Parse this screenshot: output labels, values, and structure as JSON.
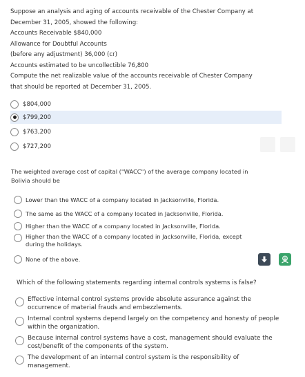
{
  "question1": {
    "lines": [
      "Suppose an analysis and aging of accounts receivable of the Chester Company at",
      "December 31, 2005, showed the following:",
      "Accounts Receivable $840,000",
      "Allowance for Doubtful Accounts",
      "(before any adjustment) 36,000 (cr)",
      "Accounts estimated to be uncollectible 76,800",
      "Compute the net realizable value of the accounts receivable of Chester Company",
      "that should be reported at December 31, 2005."
    ],
    "options": [
      "$804,000",
      "$799,200",
      "$763,200",
      "$727,200"
    ],
    "selected_index": 1
  },
  "question2": {
    "lines": [
      "The weighted average cost of capital (\"WACC\") of the average company located in",
      "Bolivia should be"
    ],
    "options": [
      "Lower than the WACC of a company located in Jacksonville, Florida.",
      "The same as the WACC of a company located in Jacksonville, Florida.",
      "Higher than the WACC of a company located in Jacksonville, Florida.",
      "Higher than the WACC of a company located in Jacksonville, Florida, except during the holidays.",
      "None of the above."
    ]
  },
  "toolbar": {
    "download_icon": "download-icon",
    "share_icon": "share-icon",
    "download_color": "#3d4a57",
    "share_color": "#3aa36a"
  },
  "question3": {
    "text": "Which of the following statements regarding internal controls systems is false?",
    "options": [
      "Effective internal control systems provide absolute assurance against the occurrence of material frauds and embezzlements.",
      "Internal control systems depend largely on the competency and honesty of people within the organization.",
      "Because internal control systems have a cost, management should evaluate the cost/benefit of the components of the system.",
      "The development of an internal control system is the responsibility of management."
    ]
  },
  "colors": {
    "selected_row_background": "#e6eef9"
  }
}
